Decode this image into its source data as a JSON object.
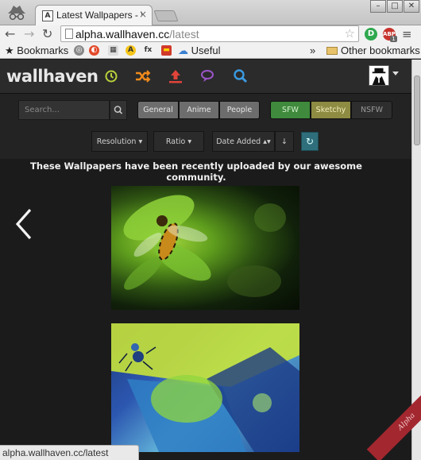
{
  "browser": {
    "tab": {
      "title": "Latest Wallpapers - \\",
      "close_icon": "×",
      "favicon_letter": "A"
    },
    "window_controls": {
      "minimize": "–",
      "maximize": "□",
      "close": "✕"
    },
    "url": {
      "host": "alpha.wallhaven.cc",
      "path": "/latest"
    },
    "extensions": {
      "d_label": "D",
      "abp_label": "ABP",
      "abp_badge": "1"
    },
    "bookmarks": {
      "left_label": "Bookmarks",
      "useful_label": "Useful",
      "overflow": "»",
      "other_label": "Other bookmarks"
    },
    "status_url": "alpha.wallhaven.cc/latest"
  },
  "site": {
    "logo": "wallhaven",
    "nav_icons": [
      "toplist-icon",
      "random-icon",
      "upload-icon",
      "forums-icon",
      "search-icon"
    ],
    "search": {
      "placeholder": "Search...",
      "categories": [
        "General",
        "Anime",
        "People"
      ],
      "purity": [
        "SFW",
        "Sketchy",
        "NSFW"
      ]
    },
    "filters": {
      "resolution": "Resolution",
      "ratio": "Ratio",
      "sort": "Date Added"
    },
    "headline": "These Wallpapers have been recently uploaded by our awesome community.",
    "ribbon": "Alpha"
  },
  "colors": {
    "accent_green": "#3f8a3c",
    "accent_sketchy": "#8e8b42",
    "alpha_ribbon": "#a3272f",
    "refresh": "#2f6f7c"
  }
}
